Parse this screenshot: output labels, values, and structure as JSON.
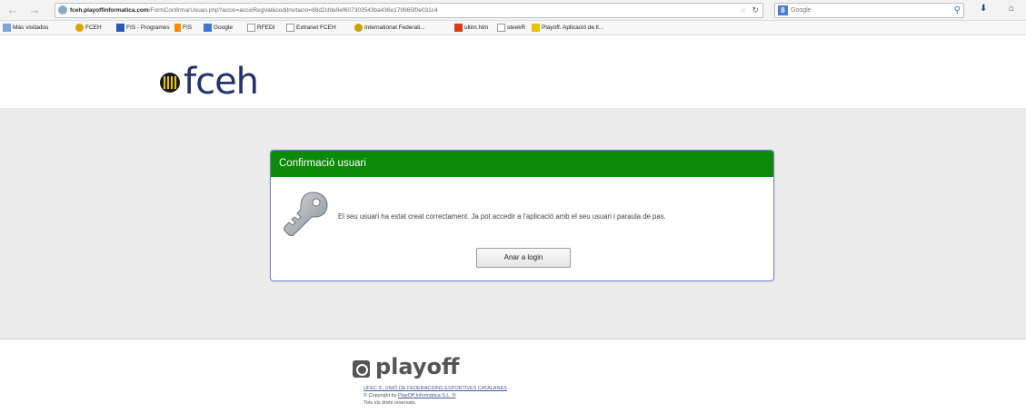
{
  "browser": {
    "url_host": "fceh.playoffinformatica.com",
    "url_path": "/FormConfirmarUsuari.php?accio=accioRegVal&codiInvitacio=88d2cfde9ef607303543ba436e179965f0e031c4",
    "search_engine": "Google",
    "search_placeholder": "Google"
  },
  "bookmarks": [
    {
      "label": "Más visitados",
      "icon": "most-visited-icon"
    },
    {
      "label": "FCEH",
      "icon": "fceh-icon"
    },
    {
      "label": "FIS - Programes",
      "icon": "fis-icon"
    },
    {
      "label": "FIS",
      "icon": "fis-small-icon"
    },
    {
      "label": "Google",
      "icon": "google-icon"
    },
    {
      "label": "RFEDI",
      "icon": "page-icon"
    },
    {
      "label": "Extranet FCEH",
      "icon": "page-icon"
    },
    {
      "label": "International Federati...",
      "icon": "federation-icon"
    },
    {
      "label": "ultim.htm",
      "icon": "html-icon"
    },
    {
      "label": "steekR",
      "icon": "page-icon"
    },
    {
      "label": "Playoff. Aplicació de ll...",
      "icon": "playoff-icon"
    }
  ],
  "header": {
    "logo_text": "fceh"
  },
  "dialog": {
    "title": "Confirmació usuari",
    "message": "El seu usuari ha estat creat correctament. Ja pot accedir a l'aplicació amb el seu usuari i paraula de pas.",
    "button_label": "Anar a login"
  },
  "footer": {
    "logo_text": "playoff",
    "line1": "UFEC ®, UNIÓ DE FEDERACIONS ESPORTIVES CATALANES",
    "line2_prefix": "© Copyright by ",
    "line2_link": "PlayOff Informàtica S.L. ®",
    "line3": "Tots els drets reservats."
  },
  "colors": {
    "dialog_header": "#0a8a06",
    "dialog_border": "#7b7ec9",
    "logo": "#24326f",
    "band": "#ececec"
  }
}
